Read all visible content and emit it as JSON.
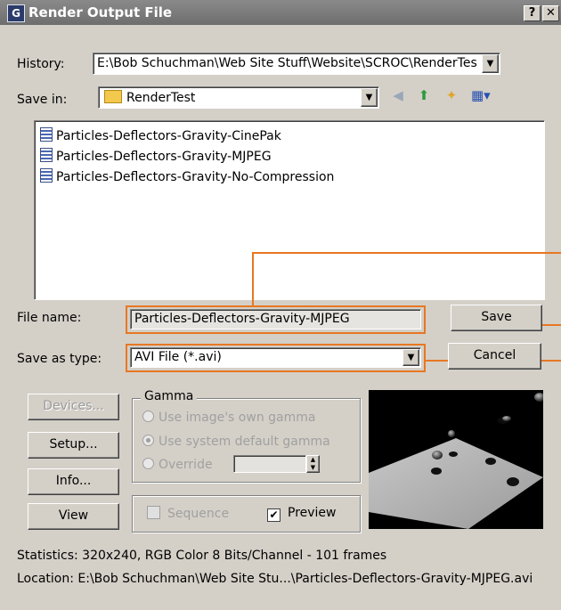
{
  "window": {
    "title": "Render Output File",
    "help_label": "?",
    "close_label": "✕",
    "app_icon_label": "G"
  },
  "history": {
    "label": "History:",
    "value": "E:\\Bob Schuchman\\Web Site Stuff\\Website\\SCROC\\RenderTes"
  },
  "save_in": {
    "label": "Save in:",
    "folder": "RenderTest"
  },
  "files": [
    "Particles-Deflectors-Gravity-CinePak",
    "Particles-Deflectors-Gravity-MJPEG",
    "Particles-Deflectors-Gravity-No-Compression"
  ],
  "file_name": {
    "label": "File name:",
    "value": "Particles-Deflectors-Gravity-MJPEG"
  },
  "save_as_type": {
    "label": "Save as type:",
    "value": "AVI File (*.avi)"
  },
  "buttons": {
    "save": "Save",
    "cancel": "Cancel",
    "devices": "Devices...",
    "setup": "Setup...",
    "info": "Info...",
    "view": "View"
  },
  "gamma": {
    "title": "Gamma",
    "option_own": "Use image's own gamma",
    "option_system": "Use system default gamma",
    "option_override": "Override",
    "override_value": ""
  },
  "options": {
    "sequence": "Sequence",
    "preview": "Preview",
    "preview_checked": true
  },
  "statistics": "Statistics: 320x240, RGB Color 8 Bits/Channel - 101 frames",
  "location": "Location: E:\\Bob Schuchman\\Web Site Stu...\\Particles-Deflectors-Gravity-MJPEG.avi",
  "colors": {
    "highlight": "#e87722",
    "dialog_bg": "#d4d0c8"
  }
}
